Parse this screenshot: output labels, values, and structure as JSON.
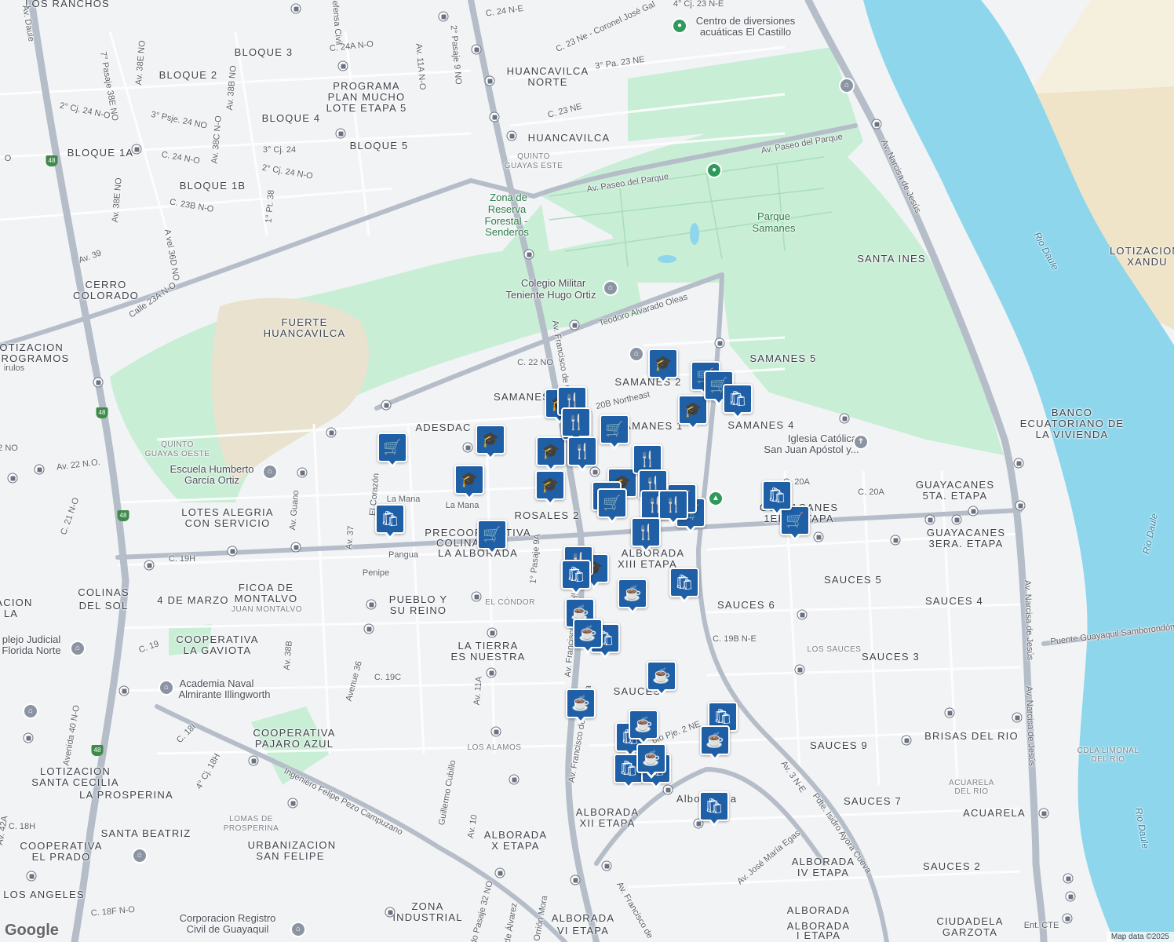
{
  "map": {
    "attribution": "Map data ©2025",
    "logo": "Google",
    "colors": {
      "water": "#8ed6ec",
      "park": "#c9eed6",
      "sand": "#efe4c8",
      "arterial": "#b5bdc9",
      "background": "#f2f3f5",
      "marker": "#1f5fa6"
    }
  },
  "labels": {
    "neighborhoods": [
      "LOS RANCHOS",
      "BLOQUE 3",
      "BLOQUE 2",
      "BLOQUE 4",
      "BLOQUE 1A",
      "BLOQUE 5",
      "BLOQUE 1B",
      "PROGRAMA",
      "PLAN MUCHO",
      "LOTE ETAPA 5",
      "HUANCAVILCA",
      "NORTE",
      "HUANCAVILCA",
      "CERRO",
      "COLORADO",
      "FUERTE",
      "HUANCAVILCA",
      "LOTIZACION",
      "PROGRAMOS",
      "SAMANES 5",
      "SAMANES 2",
      "SAMANES",
      "SAMANES 1",
      "SAMANES 4",
      "ADESDAC",
      "SANTA INES",
      "LOTIZACION",
      "XANDU",
      "BANCO",
      "ECUATORIANO DE",
      "LA VIVIENDA",
      "GUAYACANES",
      "5TA. ETAPA",
      "GUAYACANES",
      "3ERA. ETAPA",
      "GUAYACANES",
      "1ERA ETAPA",
      "ROSALES 2",
      "LOTES ALEGRIA",
      "CON SERVICIO",
      "PRECOOPERATIVA",
      "COLINA DE",
      "LA ALBORADA",
      "ALBORADA",
      "XIII ETAPA",
      "SAUCES 5",
      "SAUCES 4",
      "SAUCES 6",
      "SAUCES 3",
      "SAUCES",
      "COLINAS",
      "DEL SOL",
      "FICOA DE",
      "MONTALVO",
      "4 DE MARZO",
      "PUEBLO Y",
      "SU REINO",
      "COOPERATIVA",
      "LA GAVIOTA",
      "LA TIERRA",
      "ES NUESTRA",
      "COOPERATIVA",
      "PAJARO AZUL",
      "LOTIZACION",
      "SANTA CECILIA",
      "LA PROSPERINA",
      "SANTA BEATRIZ",
      "COOPERATIVA",
      "EL PRADO",
      "URBANIZACION",
      "SAN FELIPE",
      "LOS ANGELES",
      "ZONA",
      "INDUSTRIAL",
      "ALBORADA",
      "X ETAPA",
      "ALBORADA",
      "XII ETAPA",
      "ALBORADA",
      "SAUCES 9",
      "BRISAS DEL RIO",
      "SAUCES 7",
      "ACUARELA",
      "ALBORADA",
      "IV ETAPA",
      "SAUCES 2",
      "ALBORADA",
      "VI ETAPA",
      "ALBORADA",
      "I ETAPA",
      "CIUDADELA",
      "GARZOTA",
      "QUINTO",
      "GUAYAS ESTE",
      "QUINTO",
      "GUAYAS OESTE",
      "EL CÓNDOR",
      "LOS ALAMOS",
      "LOS SAUCES",
      "LOMAS DE",
      "PROSPERINA",
      "JUAN MONTALVO",
      "CDLA LIMONAL",
      "DEL RIO",
      "ACUARELA",
      "DEL RIO",
      "ACION",
      "LA",
      "JUAN MONTALVO"
    ],
    "streets": [
      "Av. Paseo del Parque",
      "Av. Paseo del Parque",
      "Av. Narcisa de Jesús",
      "Av. Narcisa de Jesús",
      "Av. Narcisa de Jesús",
      "Teodoro Alvarado Oleas",
      "C. 22 NO",
      "20B Northeast",
      "C. 23 NE",
      "C. 23 Ne - Coronel José Gal",
      "3° Pa. 23 NE",
      "C. 24 N-E",
      "4° Cj. 23 N-E",
      "Av. 11A N-O",
      "2° Pasaje 9 NO",
      "C. 24A N-O",
      "Av. 38E NO",
      "7° Pasaje 38E NO",
      "Av. 38B NO",
      "Av. 38C N-O",
      "3° Psje. 24 NO",
      "2° Cj. 24 N-O",
      "3° Cj. 24",
      "C. 24 N-O",
      "2° Cj. 24 N-O",
      "C. 23B N-O",
      "1° Pt. 38",
      "Av. 38E NO",
      "A vel 36D NO",
      "Av. 39",
      "Calle 23A N-O",
      "Av. 22 N.O.",
      "C. 21 N-O",
      "Av. Guano",
      "El Corazón",
      "Av. 37",
      "La Mana",
      "La Mana",
      "Pangua",
      "Penipe",
      "C. 19H",
      "Av. 38B",
      "C. 19",
      "Avenue 36",
      "C. 19C",
      "Av. 11A",
      "1° Pasaje 9A",
      "Av. Francisco de Orellana",
      "Av. Francisco de Orellana",
      "Av. Francisco de Orellana",
      "C. 20A",
      "C. 20A",
      "C. 19B N-E",
      "Puente Guayaquil Samborondón",
      "Av. 3 N-E",
      "Pdte. Isidro Ayora Cueva",
      "Av. José María Egas",
      "Ingeniero Felipe Pezo Campuzano",
      "Guillermo Cubillo",
      "Av. 10",
      "Avenida 40 N-O",
      "C. 18I",
      "4° Cj. 18H",
      "C. 18H",
      "C. 18F N-O",
      "Av. 42A",
      "Av. Francisco de",
      "2do Pasaje 32 NO",
      "de Álvarez",
      "Orrión Mora",
      "6to Pje. 2 NE",
      "Ent. CTE",
      "Av. Daule",
      "Defensa Civil",
      "irulos",
      "2 NO",
      "O"
    ],
    "water": [
      "Rio Daule",
      "Rio Daule",
      "Rio Daule"
    ],
    "parks": [
      "Parque",
      "Samanes",
      "Zona de",
      "Reserva",
      "Forestal -",
      "Senderos"
    ],
    "pois": [
      "Centro de diversiones",
      "acuáticas El Castillo",
      "Colegio Militar",
      "Teniente Hugo Ortiz",
      "Escuela Humberto",
      "García Ortiz",
      "Iglesia Católica",
      "San Juan Apóstol y...",
      "Academia Naval",
      "Almirante Illingworth",
      "Corporacion Registro",
      "Civil de Guayaquil",
      "plejo Judicial",
      "Florida Norte",
      "Albor",
      "ia"
    ]
  },
  "highway_shields": [
    "48",
    "48",
    "48",
    "48",
    "48"
  ],
  "markers": [
    {
      "type": "school",
      "icon": "🎓"
    },
    {
      "type": "school",
      "icon": "🎓"
    },
    {
      "type": "school",
      "icon": "🎓"
    },
    {
      "type": "school",
      "icon": "🎓"
    },
    {
      "type": "school",
      "icon": "🎓"
    },
    {
      "type": "school",
      "icon": "🎓"
    },
    {
      "type": "school",
      "icon": "🎓"
    },
    {
      "type": "school",
      "icon": "🎓"
    },
    {
      "type": "school",
      "icon": "🎓"
    },
    {
      "type": "school",
      "icon": "🎓"
    },
    {
      "type": "grocery",
      "icon": "🛒"
    },
    {
      "type": "grocery",
      "icon": "🛒"
    },
    {
      "type": "grocery",
      "icon": "🛒"
    },
    {
      "type": "grocery",
      "icon": "🛒"
    },
    {
      "type": "grocery",
      "icon": "🛒"
    },
    {
      "type": "grocery",
      "icon": "🛒"
    },
    {
      "type": "grocery",
      "icon": "🛒"
    },
    {
      "type": "grocery",
      "icon": "🛒"
    },
    {
      "type": "grocery",
      "icon": "🛒"
    },
    {
      "type": "grocery",
      "icon": "🛒"
    },
    {
      "type": "grocery",
      "icon": "🛒"
    },
    {
      "type": "restaurant",
      "icon": "🍴"
    },
    {
      "type": "restaurant",
      "icon": "🍴"
    },
    {
      "type": "restaurant",
      "icon": "🍴"
    },
    {
      "type": "restaurant",
      "icon": "🍴"
    },
    {
      "type": "restaurant",
      "icon": "🍴"
    },
    {
      "type": "restaurant",
      "icon": "🍴"
    },
    {
      "type": "restaurant",
      "icon": "🍴"
    },
    {
      "type": "restaurant",
      "icon": "🍴"
    },
    {
      "type": "restaurant",
      "icon": "🍴"
    },
    {
      "type": "restaurant",
      "icon": "🍴"
    },
    {
      "type": "shopping",
      "icon": "🛍"
    },
    {
      "type": "shopping",
      "icon": "🛍"
    },
    {
      "type": "shopping",
      "icon": "🛍"
    },
    {
      "type": "shopping",
      "icon": "🛍"
    },
    {
      "type": "shopping",
      "icon": "🛍"
    },
    {
      "type": "shopping",
      "icon": "🛍"
    },
    {
      "type": "shopping",
      "icon": "🛍"
    },
    {
      "type": "shopping",
      "icon": "🛍"
    },
    {
      "type": "shopping",
      "icon": "🛍"
    },
    {
      "type": "shopping",
      "icon": "🛍"
    },
    {
      "type": "shopping",
      "icon": "🛍"
    },
    {
      "type": "cafe",
      "icon": "☕"
    },
    {
      "type": "cafe",
      "icon": "☕"
    },
    {
      "type": "cafe",
      "icon": "☕"
    },
    {
      "type": "cafe",
      "icon": "☕"
    },
    {
      "type": "cafe",
      "icon": "☕"
    },
    {
      "type": "cafe",
      "icon": "☕"
    },
    {
      "type": "cafe",
      "icon": "☕"
    },
    {
      "type": "cafe",
      "icon": "☕"
    }
  ]
}
